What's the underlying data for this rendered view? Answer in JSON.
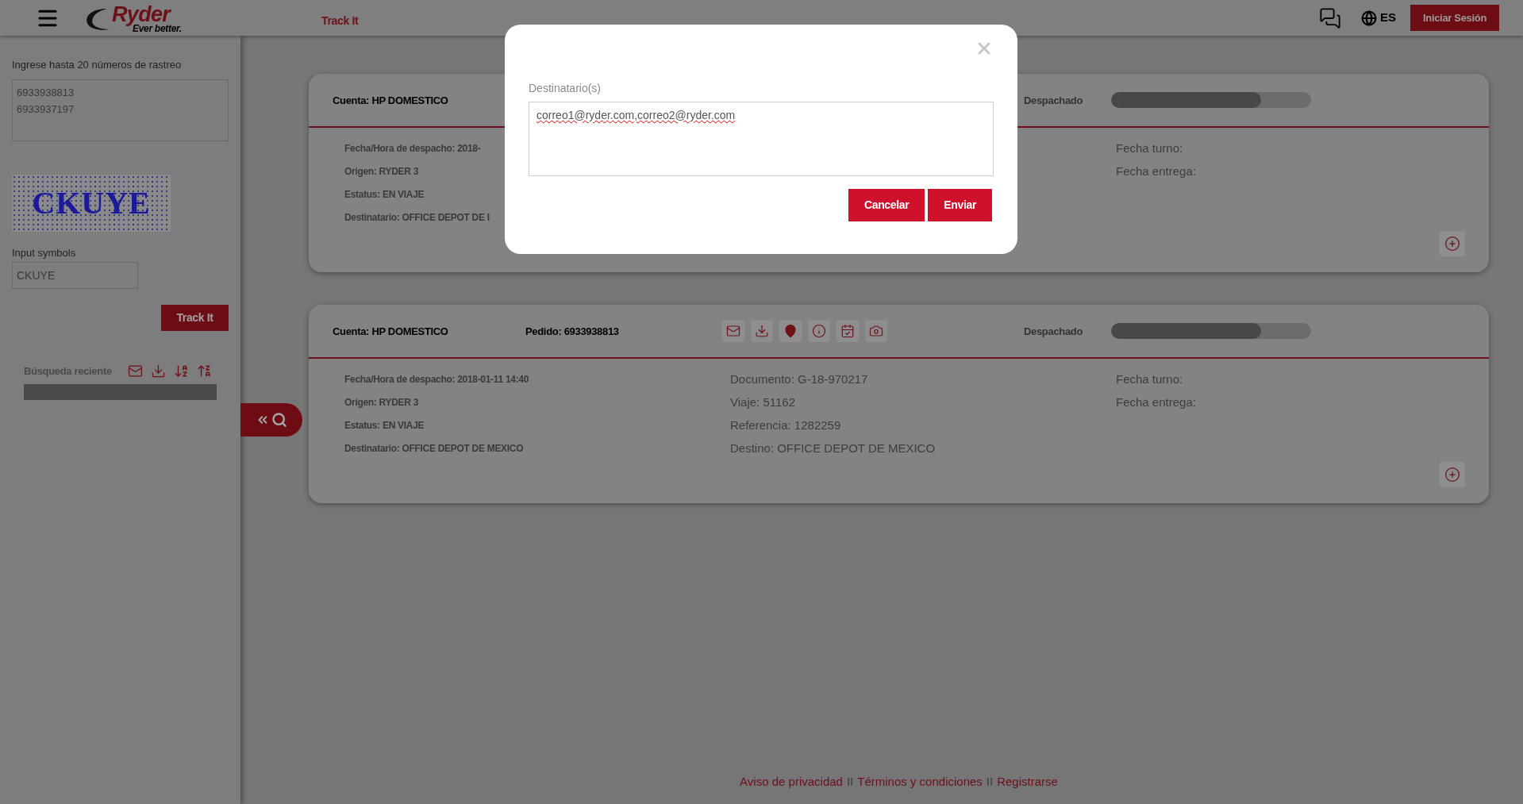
{
  "header": {
    "logo_word": "Ryder",
    "logo_tagline": "Ever better.",
    "nav_link": "Track It",
    "language": "ES",
    "login_button": "Iniciar Sesión"
  },
  "sidebar": {
    "tracking_label": "Ingrese hasta 20 números de rastreo",
    "tracking_numbers": [
      "6933938813",
      "6933937197"
    ],
    "captcha_text": "CKUYE",
    "symbols_label": "Input symbols",
    "symbols_value": "CKUYE",
    "track_button": "Track It",
    "recent_label": "Búsqueda reciente"
  },
  "shipments": [
    {
      "account": "Cuenta: HP DOMESTICO",
      "status": "Despachado",
      "level": 0.75,
      "details": [
        "Fecha/Hora de despacho: 2018-",
        "Origen: RYDER 3",
        "Estatus: EN VIAJE",
        "Destinatario: OFFICE DEPOT DE I"
      ],
      "dates": [
        "Fecha turno:",
        "Fecha entrega:"
      ]
    },
    {
      "account": "Cuenta: HP DOMESTICO",
      "order": "Pedido: 6933938813",
      "status": "Despachado",
      "level": 0.75,
      "details": [
        "Fecha/Hora de despacho: 2018-01-11 14:40",
        "Origen: RYDER 3",
        "Estatus: EN VIAJE",
        "Destinatario: OFFICE DEPOT DE MEXICO"
      ],
      "documents": [
        "Documento: G-18-970217",
        "Viaje: 51162",
        "Referencia: 1282259",
        "Destino: OFFICE DEPOT DE MEXICO"
      ],
      "dates": [
        "Fecha turno:",
        "Fecha entrega:"
      ]
    }
  ],
  "footer": [
    {
      "kind": "link",
      "text": "Aviso de privacidad"
    },
    {
      "kind": "separator",
      "text": "II"
    },
    {
      "kind": "link",
      "text": "Términos y condiciones"
    },
    {
      "kind": "separator",
      "text": "II"
    },
    {
      "kind": "link",
      "text": "Registrarse"
    }
  ],
  "modal": {
    "field_label": "Destinatario(s)",
    "field_value": "correo1@ryder.com,correo2@ryder.com",
    "buttons": [
      "Cancelar",
      "Enviar"
    ]
  }
}
